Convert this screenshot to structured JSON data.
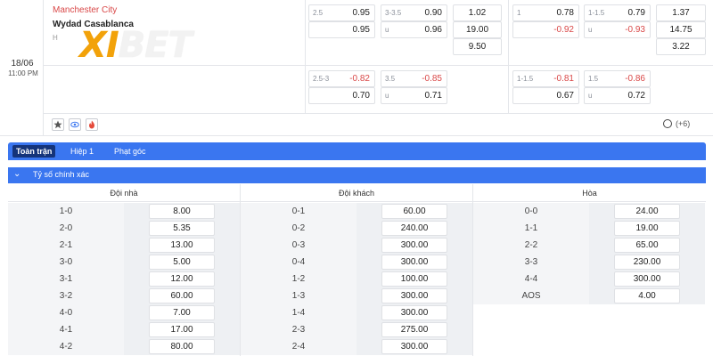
{
  "match": {
    "date": "18/06",
    "time": "11:00 PM",
    "home": "Manchester City",
    "away": "Wydad Casablanca",
    "extra": "H",
    "logo_xi": "XI",
    "logo_bet": "BET",
    "more_label": "(+6)"
  },
  "odds_top_left": [
    {
      "lbl": "2.5",
      "val": "0.95",
      "neg": false
    },
    {
      "lbl": "3-3.5",
      "val": "0.90",
      "neg": false
    },
    {
      "lbl": "",
      "val": "1.02",
      "neg": false
    },
    {
      "lbl": "",
      "val": "0.95",
      "neg": false
    },
    {
      "lbl": "u",
      "val": "0.96",
      "neg": false
    },
    {
      "lbl": "",
      "val": "19.00",
      "neg": false
    },
    {
      "lbl": "",
      "val": "9.50",
      "neg": false
    },
    {
      "lbl": "2.5-3",
      "val": "-0.82",
      "neg": true
    },
    {
      "lbl": "3.5",
      "val": "-0.85",
      "neg": true
    },
    {
      "lbl": "",
      "val": "0.70",
      "neg": false
    },
    {
      "lbl": "u",
      "val": "0.71",
      "neg": false
    }
  ],
  "odds_top_right": [
    {
      "lbl": "1",
      "val": "0.78",
      "neg": false
    },
    {
      "lbl": "1-1.5",
      "val": "0.79",
      "neg": false
    },
    {
      "lbl": "",
      "val": "1.37",
      "neg": false
    },
    {
      "lbl": "",
      "val": "-0.92",
      "neg": true
    },
    {
      "lbl": "u",
      "val": "-0.93",
      "neg": true
    },
    {
      "lbl": "",
      "val": "14.75",
      "neg": false
    },
    {
      "lbl": "",
      "val": "3.22",
      "neg": false
    },
    {
      "lbl": "1-1.5",
      "val": "-0.81",
      "neg": true
    },
    {
      "lbl": "1.5",
      "val": "-0.86",
      "neg": true
    },
    {
      "lbl": "",
      "val": "0.67",
      "neg": false
    },
    {
      "lbl": "u",
      "val": "0.72",
      "neg": false
    }
  ],
  "icons": [
    "star-icon",
    "eye-icon",
    "fire-icon"
  ],
  "tabs": [
    {
      "label": "Toàn trận",
      "active": true
    },
    {
      "label": "Hiệp 1",
      "active": false
    },
    {
      "label": "Phạt góc",
      "active": false
    }
  ],
  "section_title": "Tỷ số chính xác",
  "columns": [
    {
      "header": "Đội nhà",
      "rows": [
        {
          "score": "1-0",
          "odd": "8.00"
        },
        {
          "score": "2-0",
          "odd": "5.35"
        },
        {
          "score": "2-1",
          "odd": "13.00"
        },
        {
          "score": "3-0",
          "odd": "5.00"
        },
        {
          "score": "3-1",
          "odd": "12.00"
        },
        {
          "score": "3-2",
          "odd": "60.00"
        },
        {
          "score": "4-0",
          "odd": "7.00"
        },
        {
          "score": "4-1",
          "odd": "17.00"
        },
        {
          "score": "4-2",
          "odd": "80.00"
        }
      ]
    },
    {
      "header": "Đội khách",
      "rows": [
        {
          "score": "0-1",
          "odd": "60.00"
        },
        {
          "score": "0-2",
          "odd": "240.00"
        },
        {
          "score": "0-3",
          "odd": "300.00"
        },
        {
          "score": "0-4",
          "odd": "300.00"
        },
        {
          "score": "1-2",
          "odd": "100.00"
        },
        {
          "score": "1-3",
          "odd": "300.00"
        },
        {
          "score": "1-4",
          "odd": "300.00"
        },
        {
          "score": "2-3",
          "odd": "275.00"
        },
        {
          "score": "2-4",
          "odd": "300.00"
        }
      ]
    },
    {
      "header": "Hòa",
      "rows": [
        {
          "score": "0-0",
          "odd": "24.00"
        },
        {
          "score": "1-1",
          "odd": "19.00"
        },
        {
          "score": "2-2",
          "odd": "65.00"
        },
        {
          "score": "3-3",
          "odd": "230.00"
        },
        {
          "score": "4-4",
          "odd": "300.00"
        },
        {
          "score": "AOS",
          "odd": "4.00"
        }
      ]
    }
  ],
  "colors": {
    "accent": "#3a76f0",
    "active_tab": "#15347a",
    "negative": "#d94848",
    "logo": "#f2a20a"
  }
}
